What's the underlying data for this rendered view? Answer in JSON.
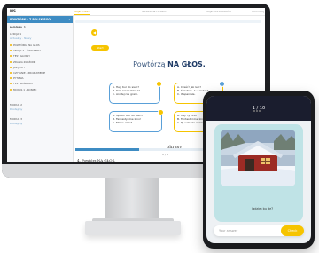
{
  "desktop": {
    "topbar": {
      "logo": "MS",
      "links": [
        "MOJE KURSY",
        "WSPARCIE UCZNIA",
        "MOJE WIADOMOŚCI",
        "WYLOGUJ"
      ]
    },
    "sidebar": {
      "header": "POWTÓRKA Z POLSKIEGO",
      "title": "MODUŁ 1",
      "level1": "LEKCJA 1",
      "level1_sub": "Aktualny · Nowy",
      "items": [
        "POWTÓRKA NA GŁOS",
        "LEKCJA 2 - ĆWICZENIA",
        "TEST GLOSSY",
        "ZDANIA ZŁOŻONE",
        "JAK JEST?",
        "CZYTANIE - ZROZUMIENIE",
        "PYTANIA",
        "TEST KOŃCOWY",
        "MODUŁ 1 - KONIEC"
      ],
      "level2": "MODUŁ 2",
      "level2_sub": "Dostępny",
      "level3": "MODUŁ 3",
      "level3_sub": "Dostępny"
    },
    "main": {
      "start_label": "Start",
      "exercise_title_prefix": "Powtórzą",
      "exercise_title_bold": "NA GŁOS.",
      "bubbles": [
        {
          "lines": [
            "A. Hej! Kur do sieci?",
            "B. Dziś kino! Idzie z?",
            "C. Ani tej nie gram."
          ]
        },
        {
          "lines": [
            "A. Cześć! Jak leci?",
            "B. Świetnie. A u ciebie?",
            "C. Wspaniale."
          ]
        },
        {
          "lines": [
            "A. Spoko! Kur do sieci?",
            "B. Fantastyczne kino!",
            "C. Mleko i bilet."
          ]
        },
        {
          "lines": [
            "A. Hej! Ty kino.",
            "B. Fantastyczne kino!",
            "C. Ty cukierki wczoraj."
          ]
        }
      ],
      "brand": "phrasy",
      "page_indicator": "1 / 8",
      "next_label": "4. Powtórz NA GŁOS."
    }
  },
  "phone": {
    "counter": "1 / 10",
    "prompt": "____ (gdzie) bu dę?",
    "answer_placeholder": "Your answer",
    "check_label": "Check"
  }
}
